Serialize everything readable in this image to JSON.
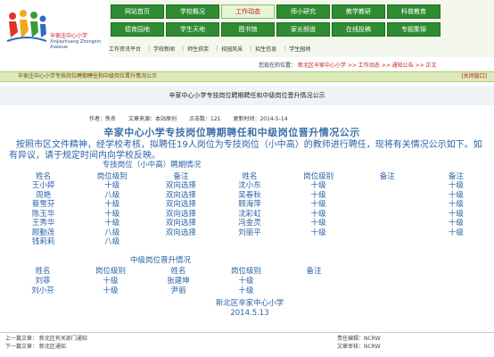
{
  "school_logo": {
    "name_cn": "辛家庄中心小学",
    "name_en": "Xinjiazhuang Zhongxin Xiaoxue"
  },
  "nav": {
    "row1": [
      "网站首页",
      "学校概况",
      "工作动态",
      "师小研究",
      "教学教研",
      "科普教育"
    ],
    "row2": [
      "德育园地",
      "学生天地",
      "图书馆",
      "家长频道",
      "在线投稿",
      "专题集锦"
    ],
    "active": "工作动态"
  },
  "subnav": [
    "工作资讯平台",
    "学校新闻",
    "师生获奖",
    "校园风采",
    "招生信息",
    "学生园地"
  ],
  "breadcrumb": {
    "prefix": "您现在的位置：",
    "path": "新北区辛家中心小学 >> 工作动态 >> 通知公告 >> 正文"
  },
  "notice_bar": {
    "text": "辛家庄中心小学专技岗位聘期聘任和中级岗位晋升情况公示",
    "close": "[关闭窗口]"
  },
  "page_header": "辛家中心小学专技岗位聘期聘任和中级岗位晋升情况公示",
  "meta": {
    "author": "作者：佚名",
    "source": "文章来源：本站原创",
    "hits": "点击数：121",
    "date": "更新时间：2014-5-14"
  },
  "article": {
    "title": "辛家中心小学专技岗位聘期聘任和中级岗位晋升情况公示",
    "intro": "按照市区文件精神，经学校考核，拟聘任19人岗位为专技岗位（小中高）的教师进行聘任，现将有关情况公示如下。如有异议，请于规定时间内向学校反映。",
    "table1": {
      "caption": "专技岗位（小中高）聘期情况",
      "headers": [
        "姓名",
        "岗位级别",
        "备注",
        "姓名",
        "岗位级别",
        "备注",
        "备注"
      ],
      "rows": [
        [
          "王小婷",
          "十级",
          "双向选择",
          "沈小东",
          "十级",
          "",
          "十级"
        ],
        [
          "周艳",
          "八级",
          "双向选择",
          "吴春秋",
          "十级",
          "",
          "十级"
        ],
        [
          "蔡雪芬",
          "十级",
          "双向选择",
          "顾海萍",
          "十级",
          "",
          "十级"
        ],
        [
          "陈玉华",
          "十级",
          "双向选择",
          "沈彩虹",
          "十级",
          "",
          "十级"
        ],
        [
          "王秀华",
          "十级",
          "双向选择",
          "冯金灵",
          "十级",
          "",
          "十级"
        ],
        [
          "顾勤莲",
          "八级",
          "双向选择",
          "刘丽平",
          "十级",
          "",
          "十级"
        ],
        [
          "钱莉莉",
          "八级",
          "",
          "",
          "",
          "",
          ""
        ]
      ]
    },
    "table2": {
      "caption": "中级岗位晋升情况",
      "headers": [
        "姓名",
        "岗位级别",
        "姓名",
        "岗位级别",
        "备注"
      ],
      "rows": [
        [
          "刘菲",
          "十级",
          "张建坤",
          "十级",
          ""
        ],
        [
          "刘小芬",
          "十级",
          "尹丽",
          "十级",
          ""
        ]
      ]
    },
    "signature": {
      "org": "新北区辛家中心小学",
      "date": "2014.5.13"
    }
  },
  "footer": {
    "prev": "上一篇文章：  新北区有关部门通知",
    "next": "下一篇文章：  新北区通知",
    "editor": "责任编辑：NCRW",
    "reviewer": "文章审核：NCRW"
  },
  "colors": {
    "nav_green": "#2f8c33",
    "nav_active_bg": "#e6f4d7",
    "accent_red": "#c41e1e",
    "article_blue": "#2b63a6",
    "notice_bg": "#dcebb9"
  }
}
